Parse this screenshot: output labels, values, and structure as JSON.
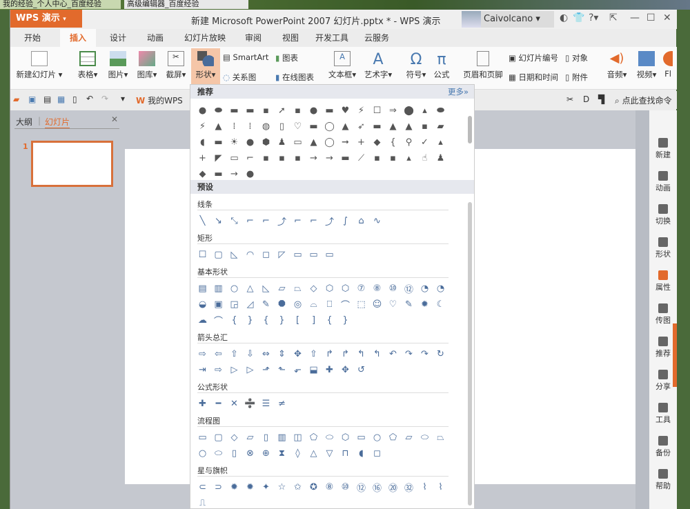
{
  "browser": {
    "tabs": [
      "我的经验_个人中心_百度经验",
      "高级编辑器_百度经验"
    ]
  },
  "app": {
    "menu_label": "WPS 演示",
    "title": "新建 Microsoft PowerPoint 2007 幻灯片.pptx * - WPS 演示",
    "user": "Caivolcano"
  },
  "tabs": [
    "开始",
    "插入",
    "设计",
    "动画",
    "幻灯片放映",
    "审阅",
    "视图",
    "开发工具",
    "云服务"
  ],
  "active_tab": "插入",
  "ribbon": {
    "new_slide": "新建幻灯片",
    "table": "表格",
    "picture": "图片",
    "gallery": "图库",
    "screenshot": "截屏",
    "shape": "形状",
    "smartart": "SmartArt",
    "chart": "图表",
    "relation": "关系图",
    "online_chart": "在线图表",
    "textbox": "文本框",
    "wordart": "艺术字",
    "symbol": "符号",
    "formula": "公式",
    "header_footer": "页眉和页脚",
    "slide_number": "幻灯片编号",
    "datetime": "日期和时间",
    "object": "对象",
    "attachment": "附件",
    "audio": "音频",
    "video": "视频",
    "flash": "Fl"
  },
  "qat": {
    "mywps": "我的WPS",
    "search": "点此查找命令"
  },
  "leftpane": {
    "tab_outline": "大纲",
    "tab_slides": "幻灯片",
    "slide_number": "1"
  },
  "panel": {
    "recommended": "推荐",
    "more": "更多»",
    "preset": "预设",
    "sections": [
      {
        "label": "线条",
        "count": 12
      },
      {
        "label": "矩形",
        "count": 9
      },
      {
        "label": "基本形状",
        "count": 42
      },
      {
        "label": "箭头总汇",
        "count": 27
      },
      {
        "label": "公式形状",
        "count": 6
      },
      {
        "label": "流程图",
        "count": 28
      },
      {
        "label": "星与旗帜",
        "count": 17
      }
    ],
    "recommended_count": 68
  },
  "sidebar": [
    "新建",
    "动画",
    "切换",
    "形状",
    "属性",
    "传图",
    "推荐",
    "分享",
    "工具",
    "备份",
    "帮助"
  ],
  "colors": {
    "accent": "#e26a2c",
    "shape_blue": "#4a6c9a"
  }
}
